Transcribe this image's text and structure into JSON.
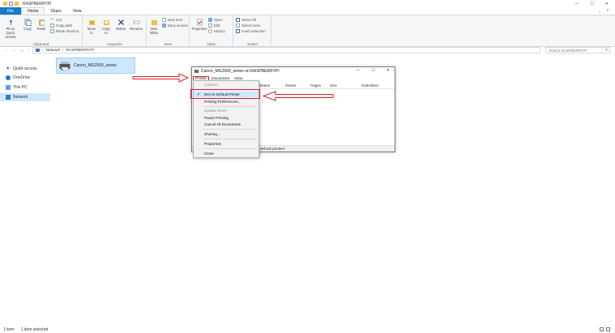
{
  "window": {
    "title": "RASPBERRYPI",
    "minimize": "—",
    "maximize": "☐",
    "close": "✕"
  },
  "ribbon_tabs": [
    "File",
    "Home",
    "Share",
    "View"
  ],
  "ribbon": {
    "clipboard": {
      "pin": "Pin to Quick access",
      "copy": "Copy",
      "paste": "Paste",
      "cut": "Cut",
      "copy_path": "Copy path",
      "paste_shortcut": "Paste shortcut",
      "label": "Clipboard"
    },
    "organize": {
      "move_to": "Move to",
      "copy_to": "Copy to",
      "delete": "Delete",
      "rename": "Rename",
      "label": "Organize"
    },
    "new": {
      "new_folder": "New folder",
      "new_item": "New item",
      "easy_access": "Easy access",
      "label": "New"
    },
    "open": {
      "properties": "Properties",
      "open": "Open",
      "edit": "Edit",
      "history": "History",
      "label": "Open"
    },
    "select": {
      "select_all": "Select all",
      "select_none": "Select none",
      "invert_selection": "Invert selection",
      "label": "Select"
    }
  },
  "address": {
    "segments": [
      "Network",
      "RASPBERRYPI"
    ],
    "search_placeholder": "Search RASPBERRYPI"
  },
  "nav_pane": [
    "Quick access",
    "OneDrive",
    "This PC",
    "Network"
  ],
  "file_item": "Canon_MG2500_series",
  "status_bar": {
    "items": "1 item",
    "selected": "1 item selected"
  },
  "dialog": {
    "title": "Canon_MG2500_series on RASPBERRYPI",
    "menu": [
      "Printer",
      "Document",
      "View"
    ],
    "columns": [
      "Status",
      "Owner",
      "Pages",
      "Size",
      "Submitted"
    ],
    "status_text": "default printers"
  },
  "context_menu": {
    "connect": "Connect",
    "set_default": "Set As Default Printer",
    "printing_prefs": "Printing Preferences...",
    "update_driver": "Update Driver",
    "pause_printing": "Pause Printing",
    "cancel_all": "Cancel All Documents",
    "sharing": "Sharing...",
    "properties": "Properties",
    "close": "Close"
  },
  "colors": {
    "accent": "#1979ca",
    "highlight": "#e01b24",
    "selection": "#cce8ff"
  }
}
